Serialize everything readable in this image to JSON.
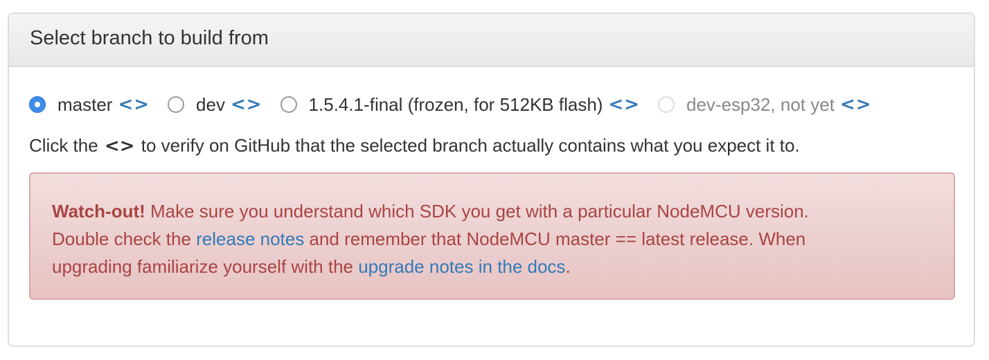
{
  "panel": {
    "title": "Select branch to build from"
  },
  "branches": [
    {
      "label": "master",
      "link_glyph": "<>",
      "checked": true,
      "disabled": false
    },
    {
      "label": "dev",
      "link_glyph": "<>",
      "checked": false,
      "disabled": false
    },
    {
      "label": "1.5.4.1-final (frozen, for 512KB flash)",
      "link_glyph": "<>",
      "checked": false,
      "disabled": false
    },
    {
      "label": "dev-esp32, not yet",
      "link_glyph": "<>",
      "checked": false,
      "disabled": true
    }
  ],
  "hint": {
    "before": "Click the ",
    "glyph": "<>",
    "after": " to verify on GitHub that the selected branch actually contains what you expect it to."
  },
  "alert": {
    "strong": "Watch-out!",
    "text1": " Make sure you understand which SDK you get with a particular NodeMCU version.",
    "text2": "Double check the ",
    "link1": "release notes",
    "text3": " and remember that NodeMCU master == latest release. When",
    "text4": "upgrading familiarize yourself with the ",
    "link2": "upgrade notes in the docs",
    "text5": "."
  },
  "colors": {
    "accent": "#337ab7",
    "radio_checked": "#3d8de8",
    "alert_text": "#a94442",
    "alert_bg": "#f2dede"
  }
}
